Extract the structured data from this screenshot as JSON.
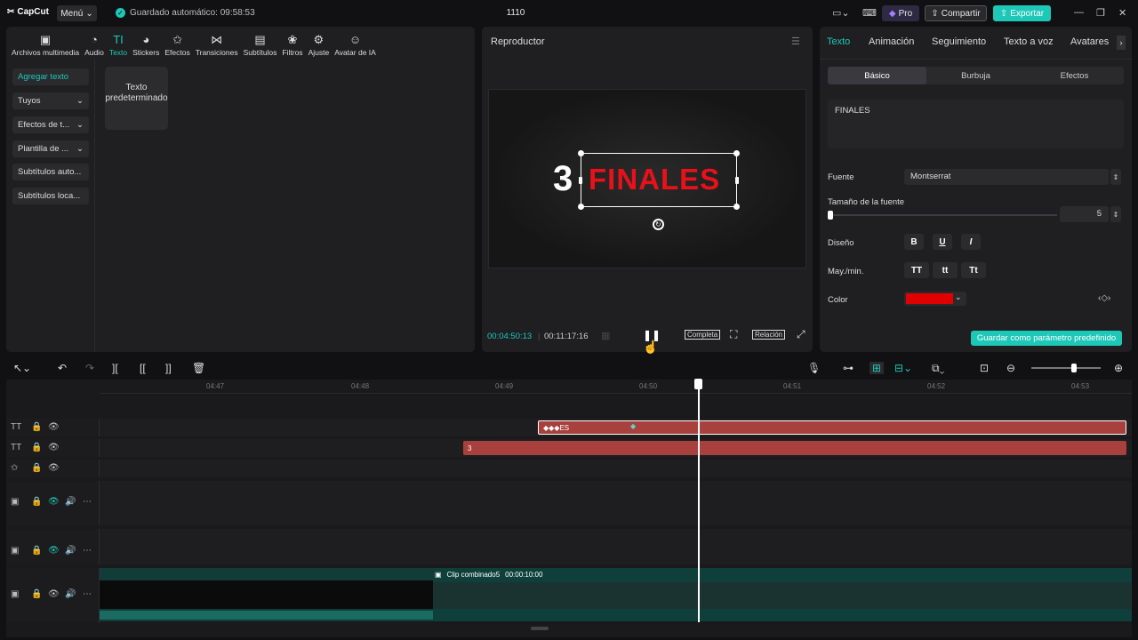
{
  "app": {
    "logo": "CapCut",
    "menu": "Menú",
    "autosave": "Guardado automático: 09:58:53",
    "project_title": "1110",
    "pro": "Pro",
    "share": "Compartir",
    "export": "Exportar"
  },
  "toolbar": {
    "items": [
      {
        "label": "Archivos multimedia",
        "icon": "media-icon"
      },
      {
        "label": "Audio",
        "icon": "audio-icon"
      },
      {
        "label": "Texto",
        "icon": "text-icon"
      },
      {
        "label": "Stickers",
        "icon": "sticker-icon"
      },
      {
        "label": "Efectos",
        "icon": "effects-icon"
      },
      {
        "label": "Transiciones",
        "icon": "transition-icon"
      },
      {
        "label": "Subtítulos",
        "icon": "subtitle-icon"
      },
      {
        "label": "Filtros",
        "icon": "filter-icon"
      },
      {
        "label": "Ajuste",
        "icon": "adjust-icon"
      },
      {
        "label": "Avatar de IA",
        "icon": "avatar-icon"
      }
    ],
    "active": "Texto"
  },
  "sidebar": {
    "items": [
      {
        "label": "Agregar texto"
      },
      {
        "label": "Tuyos"
      },
      {
        "label": "Efectos de t..."
      },
      {
        "label": "Plantilla de ..."
      },
      {
        "label": "Subtítulos auto..."
      },
      {
        "label": "Subtítulos loca..."
      }
    ]
  },
  "library": {
    "tile": "Texto predeterminado"
  },
  "player": {
    "title": "Reproductor",
    "preview_number": "3",
    "preview_text": "FINALES",
    "current_time": "00:04:50:13",
    "total_time": "00:11:17:16",
    "full_label": "Completa",
    "ratio_label": "Relación"
  },
  "inspector": {
    "tabs": [
      "Texto",
      "Animación",
      "Seguimiento",
      "Texto a voz",
      "Avatares"
    ],
    "subtabs": [
      "Básico",
      "Burbuja",
      "Efectos"
    ],
    "text_value": "FINALES",
    "font_label": "Fuente",
    "font_value": "Montserrat",
    "size_label": "Tamaño de la fuente",
    "size_value": "5",
    "style_label": "Diseño",
    "case_label": "May./min.",
    "case_options": [
      "TT",
      "tt",
      "Tt"
    ],
    "color_label": "Color",
    "color_value": "#e00000",
    "save_default": "Guardar como parámetro predefinido"
  },
  "timeline": {
    "ruler_ticks": [
      "04:47",
      "04:48",
      "04:49",
      "04:50",
      "04:51",
      "04:52",
      "04:53"
    ],
    "text_clip_1": "ES",
    "text_clip_2": "3",
    "video_clip_label": "Clip combinado5",
    "video_clip_duration": "00:00:10:00"
  }
}
